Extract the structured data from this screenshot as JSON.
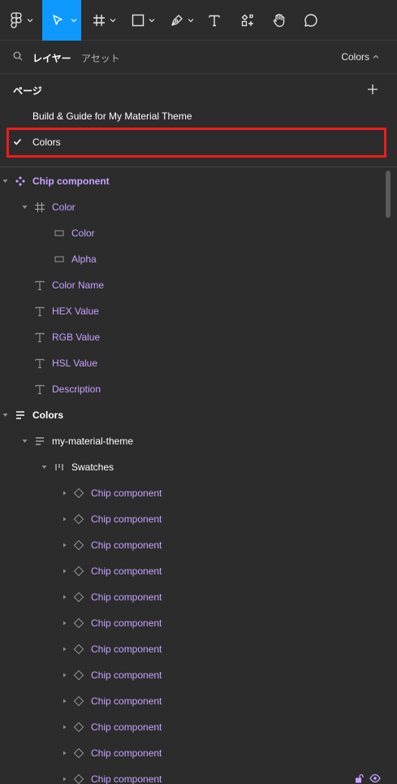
{
  "toolbar": {
    "tools": [
      "figma-menu",
      "move",
      "frame",
      "shape",
      "pen",
      "text",
      "resources",
      "hand",
      "comment"
    ]
  },
  "panel_tabs": {
    "layers_label": "レイヤー",
    "assets_label": "アセット",
    "current_page": "Colors"
  },
  "pages": {
    "heading": "ページ",
    "items": [
      {
        "label": "Build & Guide for My Material Theme",
        "selected": false
      },
      {
        "label": "Colors",
        "selected": true
      }
    ]
  },
  "layers": [
    {
      "label": "Chip component",
      "icon": "component-icon",
      "depth": 0,
      "caret": true,
      "style": "purple-bold"
    },
    {
      "label": "Color",
      "icon": "frame-icon",
      "depth": 1,
      "caret": true,
      "style": "purple"
    },
    {
      "label": "Color",
      "icon": "rectangle-icon",
      "depth": 2,
      "caret": false,
      "style": "purple"
    },
    {
      "label": "Alpha",
      "icon": "rectangle-icon",
      "depth": 2,
      "caret": false,
      "style": "purple"
    },
    {
      "label": "Color Name",
      "icon": "text-icon",
      "depth": 1,
      "caret": false,
      "style": "purple"
    },
    {
      "label": "HEX Value",
      "icon": "text-icon",
      "depth": 1,
      "caret": false,
      "style": "purple"
    },
    {
      "label": "RGB Value",
      "icon": "text-icon",
      "depth": 1,
      "caret": false,
      "style": "purple"
    },
    {
      "label": "HSL Value",
      "icon": "text-icon",
      "depth": 1,
      "caret": false,
      "style": "purple"
    },
    {
      "label": "Description",
      "icon": "text-icon",
      "depth": 1,
      "caret": false,
      "style": "purple"
    },
    {
      "label": "Colors",
      "icon": "autolayout-vertical-icon",
      "depth": 0,
      "caret": true,
      "style": "white-bold"
    },
    {
      "label": "my-material-theme",
      "icon": "autolayout-vertical-icon",
      "depth": 1,
      "caret": true,
      "style": "white"
    },
    {
      "label": "Swatches",
      "icon": "autolayout-horizontal-icon",
      "depth": 2,
      "caret": true,
      "style": "white"
    },
    {
      "label": "Chip component",
      "icon": "instance-icon",
      "depth": 3,
      "caret": "collapsed",
      "style": "purple"
    },
    {
      "label": "Chip component",
      "icon": "instance-icon",
      "depth": 3,
      "caret": "collapsed",
      "style": "purple"
    },
    {
      "label": "Chip component",
      "icon": "instance-icon",
      "depth": 3,
      "caret": "collapsed",
      "style": "purple"
    },
    {
      "label": "Chip component",
      "icon": "instance-icon",
      "depth": 3,
      "caret": "collapsed",
      "style": "purple"
    },
    {
      "label": "Chip component",
      "icon": "instance-icon",
      "depth": 3,
      "caret": "collapsed",
      "style": "purple"
    },
    {
      "label": "Chip component",
      "icon": "instance-icon",
      "depth": 3,
      "caret": "collapsed",
      "style": "purple"
    },
    {
      "label": "Chip component",
      "icon": "instance-icon",
      "depth": 3,
      "caret": "collapsed",
      "style": "purple"
    },
    {
      "label": "Chip component",
      "icon": "instance-icon",
      "depth": 3,
      "caret": "collapsed",
      "style": "purple"
    },
    {
      "label": "Chip component",
      "icon": "instance-icon",
      "depth": 3,
      "caret": "collapsed",
      "style": "purple"
    },
    {
      "label": "Chip component",
      "icon": "instance-icon",
      "depth": 3,
      "caret": "collapsed",
      "style": "purple"
    },
    {
      "label": "Chip component",
      "icon": "instance-icon",
      "depth": 3,
      "caret": "collapsed",
      "style": "purple"
    },
    {
      "label": "Chip component",
      "icon": "instance-icon",
      "depth": 3,
      "caret": "collapsed",
      "style": "purple"
    }
  ],
  "colors": {
    "background": "#2c2c2c",
    "accent": "#0d99ff",
    "component_purple": "#c7a2ff",
    "highlight_red": "#ee1c1c"
  }
}
